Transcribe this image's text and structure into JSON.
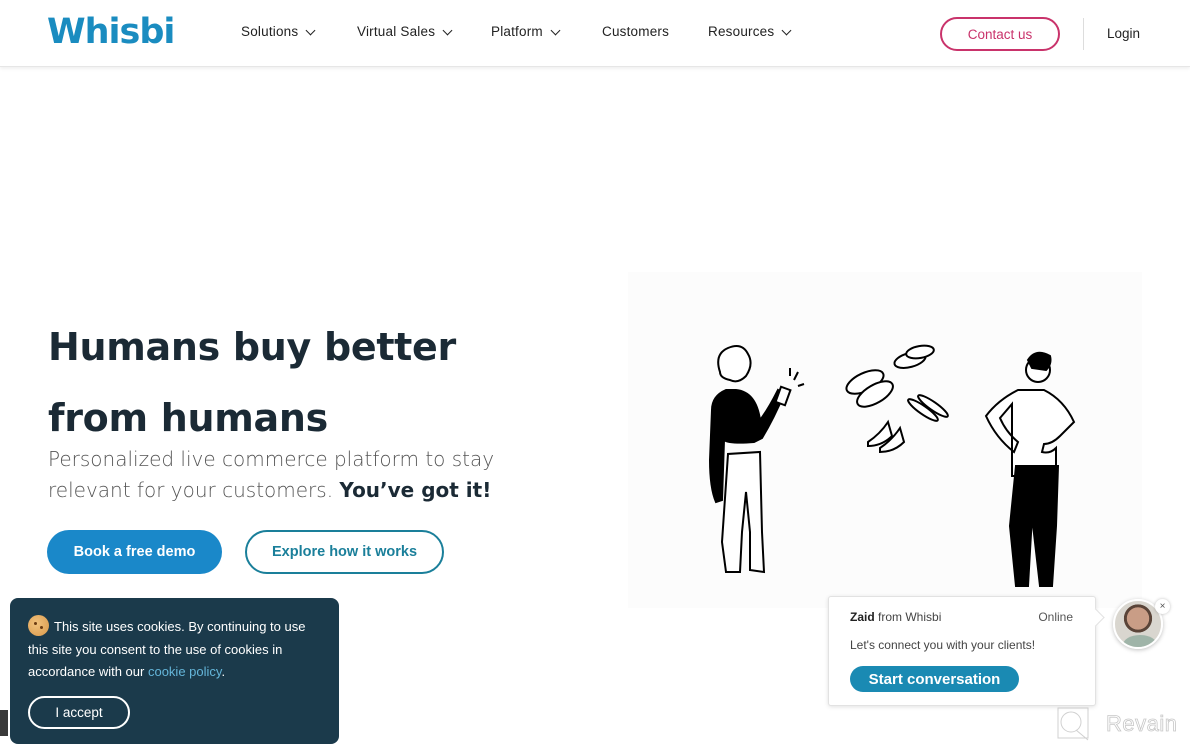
{
  "header": {
    "logo": "Whisbi",
    "nav": [
      {
        "label": "Solutions",
        "has_dropdown": true
      },
      {
        "label": "Virtual Sales",
        "has_dropdown": true
      },
      {
        "label": "Platform",
        "has_dropdown": true
      },
      {
        "label": "Customers",
        "has_dropdown": false
      },
      {
        "label": "Resources",
        "has_dropdown": true
      }
    ],
    "contact_label": "Contact us",
    "login_label": "Login"
  },
  "hero": {
    "title_line1": "Humans buy better",
    "title_line2": "from humans",
    "subtitle": "Personalized live commerce platform to stay relevant for your customers.",
    "subtitle_bold": "You’ve got it!",
    "primary_cta": "Book a free demo",
    "secondary_cta": "Explore how it works"
  },
  "illustration": {
    "description": "Woman holding phone, floating shoes, man with hands on hips"
  },
  "cookie_banner": {
    "icon": "cookie-icon",
    "text": "This site uses cookies. By continuing to use this site you consent to the use of cookies in accordance with our",
    "link_text": "cookie policy",
    "accept_label": "I accept"
  },
  "chat_widget": {
    "agent_name": "Zaid",
    "agent_from": "from Whisbi",
    "status": "Online",
    "message": "Let's connect you with your clients!",
    "button_label": "Start conversation",
    "close_icon": "×"
  },
  "watermark": {
    "text": "Revain"
  },
  "colors": {
    "brand_blue": "#1a88c9",
    "contact_pink": "#c9336b",
    "cookie_bg": "#1b3a4b",
    "chat_button": "#1a8ab3"
  }
}
